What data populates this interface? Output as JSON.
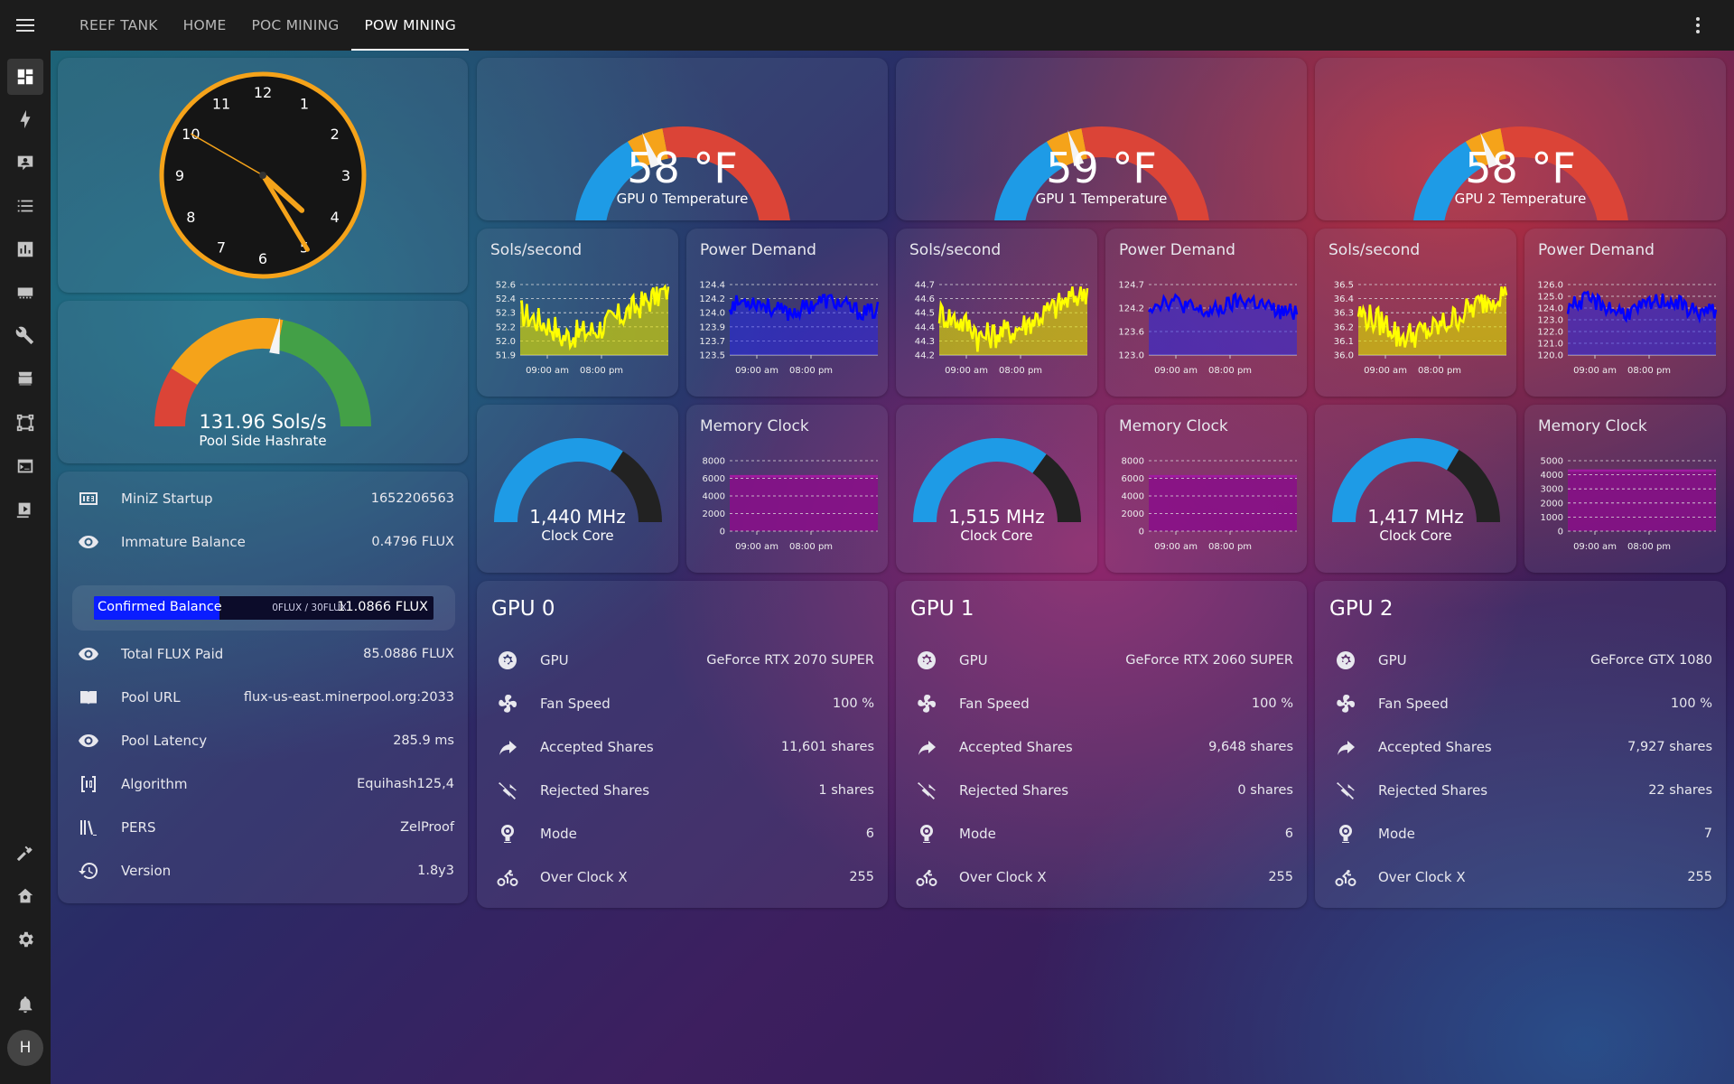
{
  "tabs": [
    {
      "label": "REEF TANK",
      "active": false
    },
    {
      "label": "HOME",
      "active": false
    },
    {
      "label": "POC MINING",
      "active": false
    },
    {
      "label": "POW MINING",
      "active": true
    }
  ],
  "sidebar": {
    "items": [
      "dashboard-icon",
      "energy-icon",
      "account-box-icon",
      "list-icon",
      "chart-icon",
      "memory-icon",
      "wrench-icon",
      "hacs-icon",
      "vector-square-icon",
      "terminal-icon",
      "media-icon"
    ],
    "bottom_items": [
      "hammer-icon",
      "home-cog-icon",
      "gear-icon",
      "bell-icon"
    ],
    "avatar": "H"
  },
  "clock": {
    "numbers": [
      "12",
      "1",
      "2",
      "3",
      "4",
      "5",
      "6",
      "7",
      "8",
      "9",
      "10",
      "11"
    ],
    "hour": 4,
    "minute": 24,
    "second": 50,
    "ring_color": "#f5a31a"
  },
  "hashrate_gauge": {
    "value": "131.96 Sols/s",
    "name": "Pool Side Hashrate",
    "level": 0.55
  },
  "miner_info": {
    "rows": [
      {
        "icon": "counter-icon",
        "label": "MiniZ Startup",
        "value": "1652206563"
      },
      {
        "icon": "eye-icon",
        "label": "Immature Balance",
        "value": "0.4796 FLUX"
      }
    ],
    "balance": {
      "label": "Confirmed Balance",
      "range": "0FLUX / 30FLUX",
      "value": "11.0866 FLUX",
      "fraction": 0.37
    },
    "rows2": [
      {
        "icon": "eye-icon",
        "label": "Total FLUX Paid",
        "value": "85.0886 FLUX"
      },
      {
        "icon": "book-icon",
        "label": "Pool URL",
        "value": "flux-us-east.minerpool.org:2033"
      },
      {
        "icon": "eye-icon",
        "label": "Pool Latency",
        "value": "285.9 ms"
      },
      {
        "icon": "code-brackets-icon",
        "label": "Algorithm",
        "value": "Equihash125,4"
      },
      {
        "icon": "library-icon",
        "label": "PERS",
        "value": "ZelProof"
      },
      {
        "icon": "history-icon",
        "label": "Version",
        "value": "1.8y3"
      }
    ]
  },
  "gpus": [
    {
      "temp": {
        "value": "58 °F",
        "name": "GPU 0 Temperature",
        "level": 0.38
      },
      "sols": {
        "title": "Sols/second",
        "ticks": [
          "52.6",
          "52.4",
          "52.3",
          "52.2",
          "52.0",
          "51.9"
        ],
        "x_ticks": [
          "09:00 am",
          "08:00 pm"
        ]
      },
      "power": {
        "title": "Power Demand",
        "ticks": [
          "124.4",
          "124.2",
          "124.0",
          "123.9",
          "123.7",
          "123.5"
        ],
        "x_ticks": [
          "09:00 am",
          "08:00 pm"
        ]
      },
      "clock": {
        "value": "1,440 MHz",
        "name": "Clock Core",
        "level": 0.68
      },
      "mem": {
        "title": "Memory Clock",
        "ticks": [
          "8000",
          "6000",
          "4000",
          "2000",
          "0"
        ],
        "x_ticks": [
          "09:00 am",
          "08:00 pm"
        ],
        "fill_level": 0.78
      },
      "title": "GPU 0",
      "rows": [
        {
          "icon": "gpu-icon",
          "label": "GPU",
          "value": "GeForce RTX 2070 SUPER"
        },
        {
          "icon": "fan-icon",
          "label": "Fan Speed",
          "value": "100 %"
        },
        {
          "icon": "share-arrow-icon",
          "label": "Accepted Shares",
          "value": "11,601 shares"
        },
        {
          "icon": "share-off-icon",
          "label": "Rejected Shares",
          "value": "1 shares"
        },
        {
          "icon": "mode-icon",
          "label": "Mode",
          "value": "6"
        },
        {
          "icon": "bike-fast-icon",
          "label": "Over Clock X",
          "value": "255"
        }
      ]
    },
    {
      "temp": {
        "value": "59 °F",
        "name": "GPU 1 Temperature",
        "level": 0.4
      },
      "sols": {
        "title": "Sols/second",
        "ticks": [
          "44.7",
          "44.6",
          "44.5",
          "44.4",
          "44.3",
          "44.2"
        ],
        "x_ticks": [
          "09:00 am",
          "08:00 pm"
        ]
      },
      "power": {
        "title": "Power Demand",
        "ticks": [
          "124.7",
          "124.2",
          "123.6",
          "123.0"
        ],
        "x_ticks": [
          "09:00 am",
          "08:00 pm"
        ]
      },
      "clock": {
        "value": "1,515 MHz",
        "name": "Clock Core",
        "level": 0.7
      },
      "mem": {
        "title": "Memory Clock",
        "ticks": [
          "8000",
          "6000",
          "4000",
          "2000",
          "0"
        ],
        "x_ticks": [
          "09:00 am",
          "08:00 pm"
        ],
        "fill_level": 0.78
      },
      "title": "GPU 1",
      "rows": [
        {
          "icon": "gpu-icon",
          "label": "GPU",
          "value": "GeForce RTX 2060 SUPER"
        },
        {
          "icon": "fan-icon",
          "label": "Fan Speed",
          "value": "100 %"
        },
        {
          "icon": "share-arrow-icon",
          "label": "Accepted Shares",
          "value": "9,648 shares"
        },
        {
          "icon": "share-off-icon",
          "label": "Rejected Shares",
          "value": "0 shares"
        },
        {
          "icon": "mode-icon",
          "label": "Mode",
          "value": "6"
        },
        {
          "icon": "bike-fast-icon",
          "label": "Over Clock X",
          "value": "255"
        }
      ]
    },
    {
      "temp": {
        "value": "58 °F",
        "name": "GPU 2 Temperature",
        "level": 0.38
      },
      "sols": {
        "title": "Sols/second",
        "ticks": [
          "36.5",
          "36.4",
          "36.3",
          "36.2",
          "36.1",
          "36.0"
        ],
        "x_ticks": [
          "09:00 am",
          "08:00 pm"
        ]
      },
      "power": {
        "title": "Power Demand",
        "ticks": [
          "126.0",
          "125.0",
          "124.0",
          "123.0",
          "122.0",
          "121.0",
          "120.0"
        ],
        "x_ticks": [
          "09:00 am",
          "08:00 pm"
        ]
      },
      "clock": {
        "value": "1,417 MHz",
        "name": "Clock Core",
        "level": 0.67
      },
      "mem": {
        "title": "Memory Clock",
        "ticks": [
          "5000",
          "4000",
          "3000",
          "2000",
          "1000",
          "0"
        ],
        "x_ticks": [
          "09:00 am",
          "08:00 pm"
        ],
        "fill_level": 0.86
      },
      "title": "GPU 2",
      "rows": [
        {
          "icon": "gpu-icon",
          "label": "GPU",
          "value": "GeForce GTX 1080"
        },
        {
          "icon": "fan-icon",
          "label": "Fan Speed",
          "value": "100 %"
        },
        {
          "icon": "share-arrow-icon",
          "label": "Accepted Shares",
          "value": "7,927 shares"
        },
        {
          "icon": "share-off-icon",
          "label": "Rejected Shares",
          "value": "22 shares"
        },
        {
          "icon": "mode-icon",
          "label": "Mode",
          "value": "7"
        },
        {
          "icon": "bike-fast-icon",
          "label": "Over Clock X",
          "value": "255"
        }
      ]
    }
  ],
  "colors": {
    "gauge_blue": "#1e9be6",
    "gauge_orange": "#f5a31a",
    "gauge_red": "#db4437",
    "gauge_green": "#43a047",
    "sols_line": "#ffff00",
    "power_line": "#0000ff",
    "mem_fill": "#8a0e8a",
    "clock_dark": "#222222"
  }
}
